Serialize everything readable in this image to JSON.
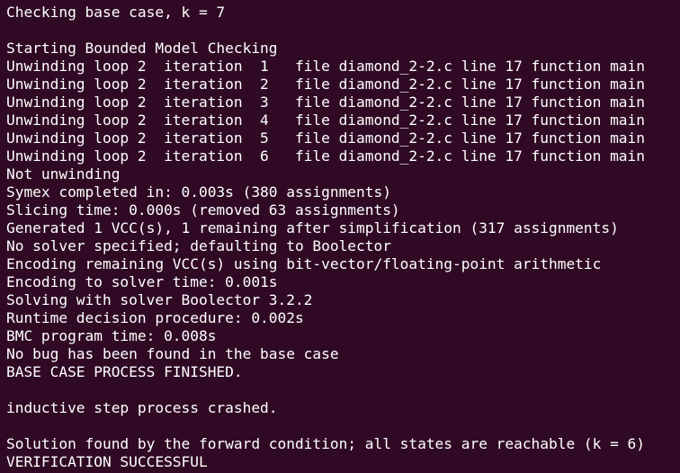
{
  "terminal": {
    "lines": [
      "Checking base case, k = 7",
      "",
      "Starting Bounded Model Checking",
      "Unwinding loop 2  iteration  1   file diamond_2-2.c line 17 function main",
      "Unwinding loop 2  iteration  2   file diamond_2-2.c line 17 function main",
      "Unwinding loop 2  iteration  3   file diamond_2-2.c line 17 function main",
      "Unwinding loop 2  iteration  4   file diamond_2-2.c line 17 function main",
      "Unwinding loop 2  iteration  5   file diamond_2-2.c line 17 function main",
      "Unwinding loop 2  iteration  6   file diamond_2-2.c line 17 function main",
      "Not unwinding",
      "Symex completed in: 0.003s (380 assignments)",
      "Slicing time: 0.000s (removed 63 assignments)",
      "Generated 1 VCC(s), 1 remaining after simplification (317 assignments)",
      "No solver specified; defaulting to Boolector",
      "Encoding remaining VCC(s) using bit-vector/floating-point arithmetic",
      "Encoding to solver time: 0.001s",
      "Solving with solver Boolector 3.2.2",
      "Runtime decision procedure: 0.002s",
      "BMC program time: 0.008s",
      "No bug has been found in the base case",
      "BASE CASE PROCESS FINISHED.",
      "",
      "inductive step process crashed.",
      "",
      "Solution found by the forward condition; all states are reachable (k = 6)",
      "VERIFICATION SUCCESSFUL"
    ]
  },
  "colors": {
    "background": "#300a24",
    "foreground": "#ffffff"
  }
}
